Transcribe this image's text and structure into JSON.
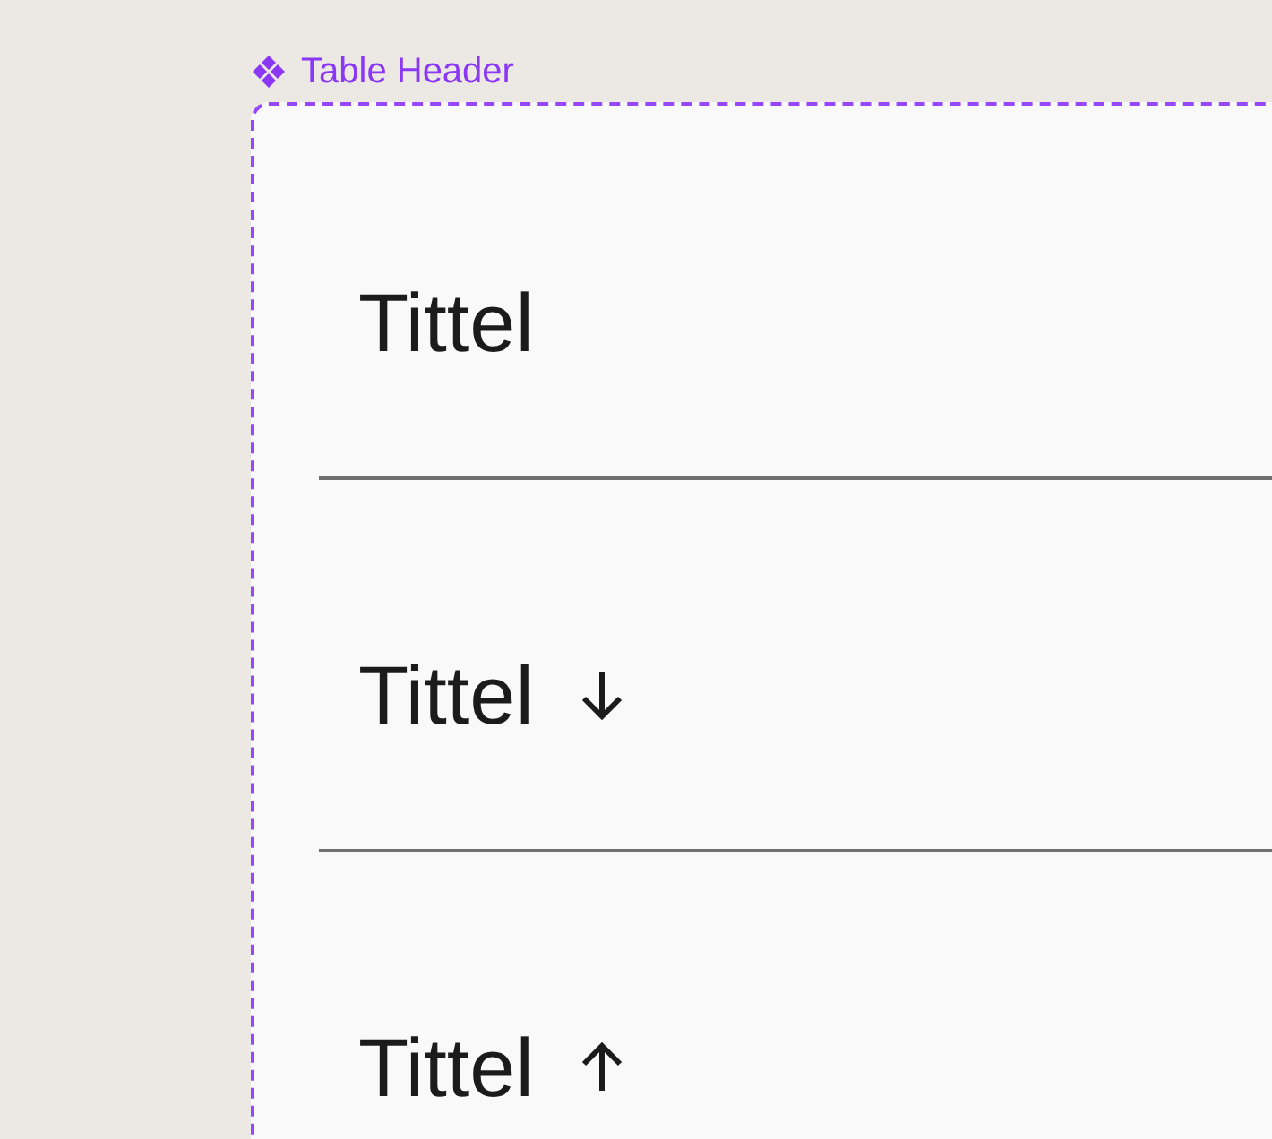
{
  "component": {
    "title": "Table Header"
  },
  "headers": [
    {
      "label": "Tittel",
      "kind": "plain"
    },
    {
      "label": "Tittel",
      "kind": "sort-descending"
    },
    {
      "label": "Tittel",
      "kind": "sort-ascending"
    }
  ]
}
